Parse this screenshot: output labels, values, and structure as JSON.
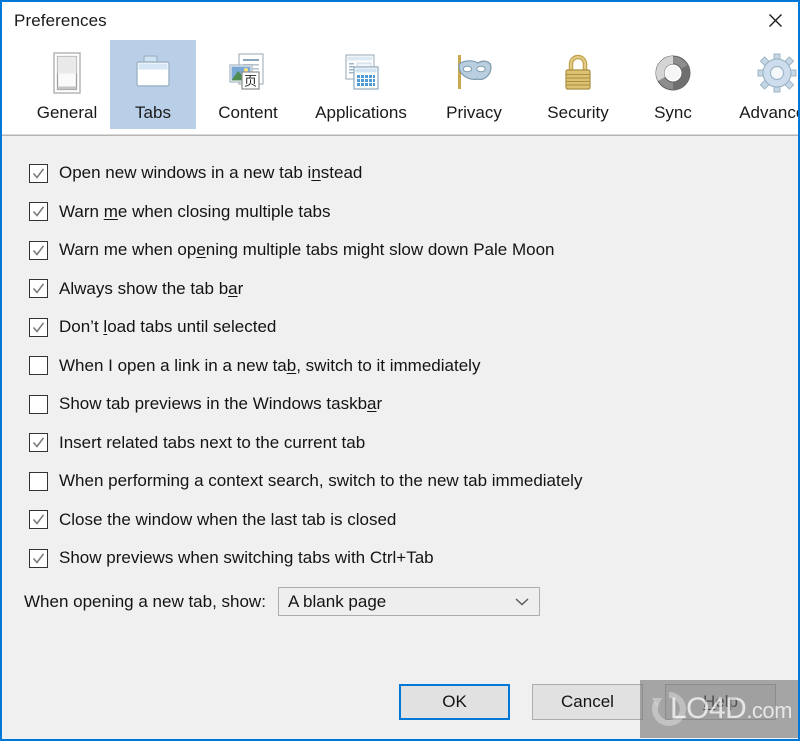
{
  "window": {
    "title": "Preferences",
    "close_icon": "close-icon",
    "border_color": "#0078d7",
    "content_bg": "#f0f0f0"
  },
  "tabs": [
    {
      "label": "General",
      "icon": "window-icon",
      "selected": false
    },
    {
      "label": "Tabs",
      "icon": "folder-tab-icon",
      "selected": true
    },
    {
      "label": "Content",
      "icon": "content-page-icon",
      "selected": false
    },
    {
      "label": "Applications",
      "icon": "applications-icon",
      "selected": false
    },
    {
      "label": "Privacy",
      "icon": "mask-icon",
      "selected": false
    },
    {
      "label": "Security",
      "icon": "padlock-icon",
      "selected": false
    },
    {
      "label": "Sync",
      "icon": "sync-arrows-icon",
      "selected": false
    },
    {
      "label": "Advanced",
      "icon": "gear-icon",
      "selected": false
    }
  ],
  "selected_tab": "Tabs",
  "options": [
    {
      "label": "Open new windows in a new tab instead",
      "checked": true,
      "accel": "t",
      "accel_index": 31
    },
    {
      "label": "Warn me when closing multiple tabs",
      "checked": true,
      "accel": "m",
      "accel_index": 5
    },
    {
      "label": "Warn me when opening multiple tabs might slow down Pale Moon",
      "checked": true,
      "accel": "o",
      "accel_index": 15
    },
    {
      "label": "Always show the tab bar",
      "checked": true,
      "accel": "b",
      "accel_index": 21
    },
    {
      "label": "Don’t load tabs until selected",
      "checked": true,
      "accel": "l",
      "accel_index": 6
    },
    {
      "label": "When I open a link in a new tab, switch to it immediately",
      "checked": false,
      "accel": "s",
      "accel_index": 30
    },
    {
      "label": "Show tab previews in the Windows taskbar",
      "checked": false,
      "accel": "k",
      "accel_index": 38
    },
    {
      "label": "Insert related tabs next to the current tab",
      "checked": true,
      "accel": "",
      "accel_index": -1
    },
    {
      "label": "When performing a context search, switch to the new tab immediately",
      "checked": false,
      "accel": "",
      "accel_index": -1
    },
    {
      "label": "Close the window when the last tab is closed",
      "checked": true,
      "accel": "",
      "accel_index": -1
    },
    {
      "label": "Show previews when switching tabs with Ctrl+Tab",
      "checked": true,
      "accel": "",
      "accel_index": -1
    }
  ],
  "new_tab_setting": {
    "label": "When opening a new tab, show:",
    "value": "A blank page",
    "arrow_icon": "chevron-down-icon"
  },
  "buttons": {
    "ok": "OK",
    "cancel": "Cancel",
    "help": "Help",
    "default_button": "OK",
    "focus_color": "#0078d7"
  },
  "watermark": {
    "text_main": "LO4D",
    "text_suffix": ".com"
  }
}
